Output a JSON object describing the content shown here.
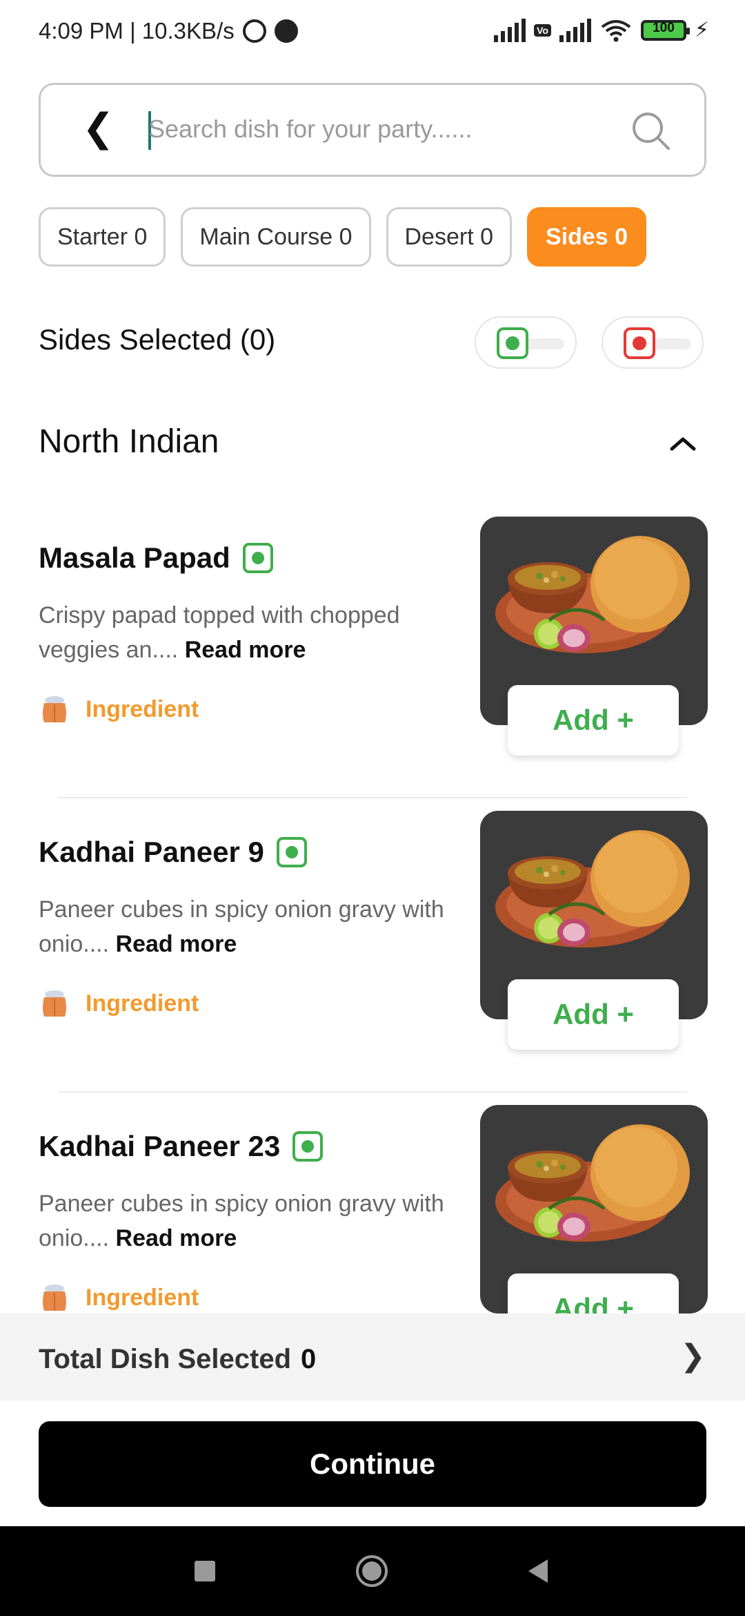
{
  "status_bar": {
    "time_speed": "4:09 PM | 10.3KB/s",
    "battery": "100"
  },
  "search": {
    "placeholder": "Search dish for your party......",
    "value": ""
  },
  "tabs": [
    {
      "label": "Starter 0",
      "active": false
    },
    {
      "label": "Main Course 0",
      "active": false
    },
    {
      "label": "Desert 0",
      "active": false
    },
    {
      "label": "Sides 0",
      "active": true
    }
  ],
  "selected_header": {
    "label": "Sides Selected (0)"
  },
  "section": {
    "title": "North Indian"
  },
  "dishes": [
    {
      "name": "Masala Papad",
      "desc": "Crispy papad topped with chopped veggies an....",
      "read_more": "Read more",
      "ingredient": "Ingredient",
      "add_label": "Add +"
    },
    {
      "name": "Kadhai Paneer 9",
      "desc": "Paneer cubes in spicy onion gravy with onio....",
      "read_more": "Read more",
      "ingredient": "Ingredient",
      "add_label": "Add +"
    },
    {
      "name": "Kadhai Paneer 23",
      "desc": "Paneer cubes in spicy onion gravy with onio....",
      "read_more": "Read more",
      "ingredient": "Ingredient",
      "add_label": "Add +"
    }
  ],
  "summary": {
    "label": "Total Dish Selected",
    "count": "0"
  },
  "continue_label": "Continue",
  "colors": {
    "accent_orange": "#fb8c1e",
    "veg_green": "#3fae4d",
    "nonveg_red": "#e53935",
    "ingredient_orange": "#f29a2e"
  }
}
